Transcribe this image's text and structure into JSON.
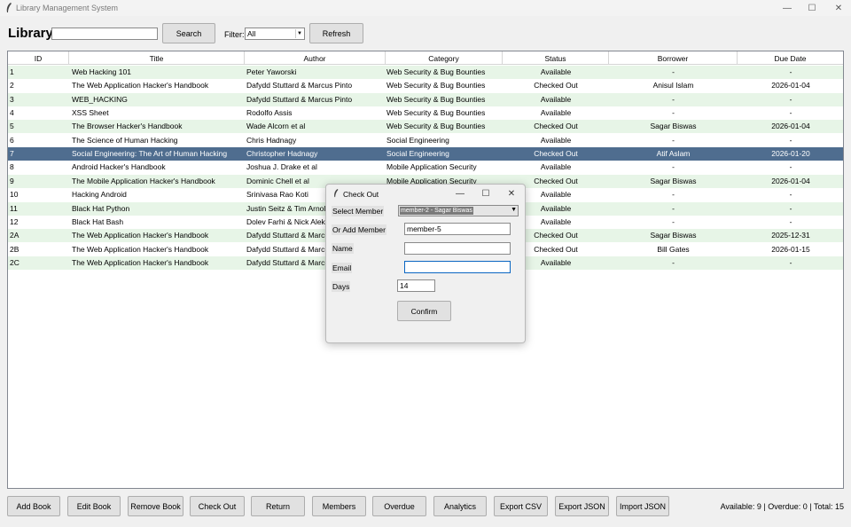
{
  "window": {
    "title": "Library Management System",
    "minimize_glyph": "—",
    "maximize_glyph": "☐",
    "close_glyph": "✕"
  },
  "toolbar": {
    "heading": "Library",
    "search_value": "",
    "search_button": "Search",
    "filter_label": "Filter:",
    "filter_value": "All",
    "refresh_button": "Refresh"
  },
  "table": {
    "columns": [
      "ID",
      "Title",
      "Author",
      "Category",
      "Status",
      "Borrower",
      "Due Date"
    ],
    "selected_row_index": 6,
    "rows": [
      [
        "1",
        "Web Hacking 101",
        "Peter Yaworski",
        "Web Security & Bug Bounties",
        "Available",
        "-",
        "-"
      ],
      [
        "2",
        "The Web Application Hacker's Handbook",
        "Dafydd Stuttard & Marcus Pinto",
        "Web Security & Bug Bounties",
        "Checked Out",
        "Anisul Islam",
        "2026-01-04"
      ],
      [
        "3",
        "WEB_HACKING",
        "Dafydd Stuttard & Marcus Pinto",
        "Web Security & Bug Bounties",
        "Available",
        "-",
        "-"
      ],
      [
        "4",
        "XSS Sheet",
        "Rodolfo Assis",
        "Web Security & Bug Bounties",
        "Available",
        "-",
        "-"
      ],
      [
        "5",
        "The Browser Hacker's Handbook",
        "Wade Alcorn et al",
        "Web Security & Bug Bounties",
        "Checked Out",
        "Sagar Biswas",
        "2026-01-04"
      ],
      [
        "6",
        "The Science of Human Hacking",
        "Chris Hadnagy",
        "Social Engineering",
        "Available",
        "-",
        "-"
      ],
      [
        "7",
        "Social Engineering: The Art of Human Hacking",
        "Christopher Hadnagy",
        "Social Engineering",
        "Checked Out",
        "Atif Aslam",
        "2026-01-20"
      ],
      [
        "8",
        "Android Hacker's Handbook",
        "Joshua J. Drake et al",
        "Mobile Application Security",
        "Available",
        "-",
        "-"
      ],
      [
        "9",
        "The Mobile Application Hacker's Handbook",
        "Dominic Chell et al",
        "Mobile Application Security",
        "Checked Out",
        "Sagar Biswas",
        "2026-01-04"
      ],
      [
        "10",
        "Hacking Android",
        "Srinivasa Rao Koti",
        "",
        "Available",
        "-",
        "-"
      ],
      [
        "11",
        "Black Hat Python",
        "Justin Seitz & Tim Arnold",
        "",
        "Available",
        "-",
        "-"
      ],
      [
        "12",
        "Black Hat Bash",
        "Dolev Farhi & Nick Aleks",
        "",
        "Available",
        "-",
        "-"
      ],
      [
        "2A",
        "The Web Application Hacker's Handbook",
        "Dafydd Stuttard & Marcus Pinto",
        "",
        "Checked Out",
        "Sagar Biswas",
        "2025-12-31"
      ],
      [
        "2B",
        "The Web Application Hacker's Handbook",
        "Dafydd Stuttard & Marcus Pinto",
        "",
        "Checked Out",
        "Bill Gates",
        "2026-01-15"
      ],
      [
        "2C",
        "The Web Application Hacker's Handbook",
        "Dafydd Stuttard & Marcus Pinto",
        "",
        "Available",
        "-",
        "-"
      ]
    ]
  },
  "actions": [
    "Add Book",
    "Edit Book",
    "Remove Book",
    "Check Out",
    "Return",
    "Members",
    "Overdue",
    "Analytics",
    "Export CSV",
    "Export JSON",
    "Import JSON"
  ],
  "status_text": "Available: 9 | Overdue: 0 | Total: 15",
  "dialog": {
    "title": "Check Out",
    "select_member_label": "Select Member",
    "select_member_value": "member-2 - Sagar Biswas",
    "add_member_label": "Or Add Member",
    "add_member_value": "member-5",
    "name_label": "Name",
    "name_value": "",
    "email_label": "Email",
    "email_value": "",
    "days_label": "Days",
    "days_value": "14",
    "confirm_button": "Confirm"
  },
  "colors": {
    "row_even": "#e7f5e7",
    "row_selected": "#4f6d8f"
  }
}
